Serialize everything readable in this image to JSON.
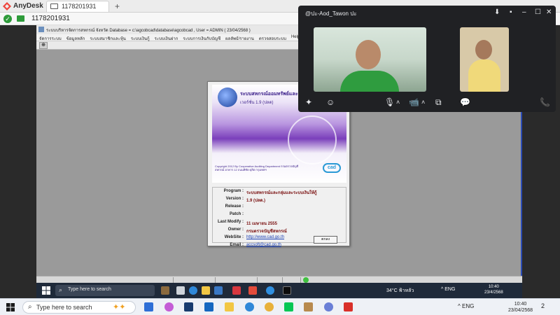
{
  "anydesk": {
    "app_name": "AnyDesk",
    "tab_label": "1178201931",
    "tab_add": "+",
    "address": "1178201931",
    "brand_color": "#ef443b"
  },
  "remote_app": {
    "title": "ระบบบริหารจัดการสหกรณ์ จังหวัด Database = c:\\agcobcad\\database\\agcobcad , User = ADMIN ( 23/04/2568 )",
    "menu": [
      "จัดการระบบ",
      "ข้อมูลหลัก",
      "ระบบสมาชิกและหุ้น",
      "ระบบเงินกู้",
      "ระบบเงินฝาก",
      "ระบบการเงินกับบัญชี",
      "ผลลัพธ์/รายงาน",
      "ตรวจสอบระบบ",
      "Help"
    ],
    "toolbar_btn": "⊕"
  },
  "about": {
    "banner_title": "ระบบสหกรณ์ออมทรัพย์และการเงิน",
    "banner_version": "เวอร์ชั่น 1.9 (ปลด)",
    "banner_copy": "Copyright 2012 By Cooperative Auditing Department  กรมตรวจบัญชีสหกรณ์ อาคาร 12 ถนนพิชัย ดุสิต กรุงเทพฯ",
    "banner_logo": "cad",
    "rows": [
      {
        "k": "Program :",
        "v": "ระบบสหกรณ์และกลุ่มและระบบเงินให้กู้",
        "link": false
      },
      {
        "k": "Version :",
        "v": "1.9 (ปลด.)",
        "link": false
      },
      {
        "k": "Release :",
        "v": "",
        "link": false
      },
      {
        "k": "Patch :",
        "v": "",
        "link": false
      },
      {
        "k": "Last Modify :",
        "v": "11 เมษายน 2555",
        "link": false
      },
      {
        "k": "Owner :",
        "v": "กรมตรวจบัญชีสหกรณ์",
        "link": false
      },
      {
        "k": "WebSite :",
        "v": "http://www.cad.go.th",
        "link": true
      },
      {
        "k": "Email :",
        "v": "accsoft@cad.go.th",
        "link": true
      }
    ],
    "ok_label": "ตกลง"
  },
  "meet": {
    "title": "@ปะ-Aod_Tawon ปะ",
    "controls_top": [
      "⬇",
      "▪",
      "–",
      "☐",
      "✕"
    ],
    "controls_bottom": [
      "✦",
      "☺",
      "🎙",
      "˄",
      "📹",
      "˄",
      "⧉",
      "💬"
    ],
    "end_call": "📞",
    "end_call_color": "#ea4335"
  },
  "inner_taskbar": {
    "search_placeholder": "Type here to search",
    "weather": "34°C ฟ้าหลัว",
    "tray": "^  ENG",
    "time": "10:40",
    "date": "23/4/2568"
  },
  "outer_taskbar": {
    "search_placeholder": "Type here to search",
    "tray": "^  ENG",
    "time": "10:40",
    "date": "23/04/2568",
    "notif_count": "2"
  }
}
